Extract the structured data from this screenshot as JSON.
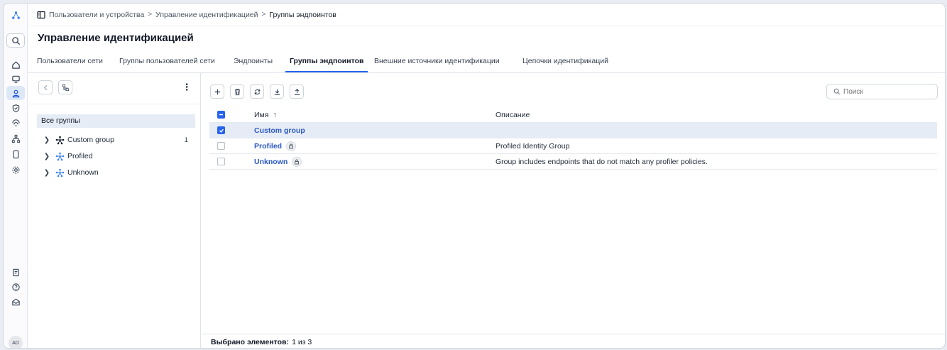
{
  "breadcrumb": {
    "items": [
      "Пользователи и устройства",
      "Управление идентификацией",
      "Группы эндпоинтов"
    ],
    "separator": ">"
  },
  "page": {
    "title": "Управление идентификацией"
  },
  "tabs": [
    {
      "label": "Пользователи сети",
      "active": false
    },
    {
      "label": "Группы пользователей сети",
      "active": false
    },
    {
      "label": "Эндпоинты",
      "active": false
    },
    {
      "label": "Группы эндпоинтов",
      "active": true
    },
    {
      "label": "Внешние источники идентификации",
      "active": false
    },
    {
      "label": "Цепочки идентификаций",
      "active": false
    }
  ],
  "rail": {
    "icons": [
      "app-logo-icon",
      "search-icon",
      "home-icon",
      "monitor-icon",
      "users-icon",
      "shield-icon",
      "wireless-icon",
      "network-icon",
      "device-icon",
      "settings-icon",
      "clipboard-icon",
      "help-icon",
      "mail-icon"
    ],
    "active": "users-icon",
    "avatar": "AD"
  },
  "tree": {
    "root_label": "Все группы",
    "nodes": [
      {
        "label": "Custom group",
        "count": "1",
        "icon": "group-icon-dark"
      },
      {
        "label": "Profiled",
        "count": "",
        "icon": "group-icon-blue"
      },
      {
        "label": "Unknown",
        "count": "",
        "icon": "group-icon-blue"
      }
    ]
  },
  "search": {
    "placeholder": "Поиск"
  },
  "table": {
    "columns": [
      "Имя",
      "Описание"
    ],
    "sort_indicator": "↑",
    "rows": [
      {
        "name": "Custom group",
        "description": "",
        "locked": false,
        "selected": true
      },
      {
        "name": "Profiled",
        "description": "Profiled Identity Group",
        "locked": true,
        "selected": false
      },
      {
        "name": "Unknown",
        "description": "Group includes endpoints that do not match any profiler policies.",
        "locked": true,
        "selected": false
      }
    ]
  },
  "footer": {
    "label": "Выбрано элементов:",
    "value": "1 из 3"
  },
  "colors": {
    "accent": "#2563eb",
    "link": "#2b59c3",
    "selected_row": "#e6ecf6"
  }
}
